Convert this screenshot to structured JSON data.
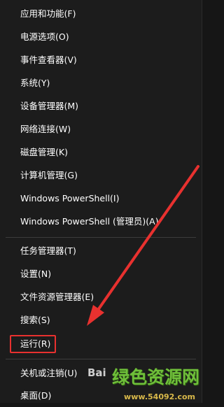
{
  "menu": {
    "items": [
      {
        "label": "应用和功能(F)"
      },
      {
        "label": "电源选项(O)"
      },
      {
        "label": "事件查看器(V)"
      },
      {
        "label": "系统(Y)"
      },
      {
        "label": "设备管理器(M)"
      },
      {
        "label": "网络连接(W)"
      },
      {
        "label": "磁盘管理(K)"
      },
      {
        "label": "计算机管理(G)"
      },
      {
        "label": "Windows PowerShell(I)"
      },
      {
        "label": "Windows PowerShell (管理员)(A)"
      },
      {
        "label": "任务管理器(T)"
      },
      {
        "label": "设置(N)"
      },
      {
        "label": "文件资源管理器(E)"
      },
      {
        "label": "搜索(S)"
      },
      {
        "label": "运行(R)"
      },
      {
        "label": "关机或注销(U)",
        "submenu_icon": "›"
      },
      {
        "label": "桌面(D)"
      }
    ]
  },
  "annotation": {
    "highlight_color": "#e8312f",
    "target_item": "运行(R)"
  },
  "watermark": {
    "title": "绿色资源网",
    "url": "www.54092.com",
    "badge": "Bai"
  },
  "colors": {
    "menu_background": "#1c1c1c",
    "text": "#ffffff",
    "separator": "#3c3c3c"
  }
}
